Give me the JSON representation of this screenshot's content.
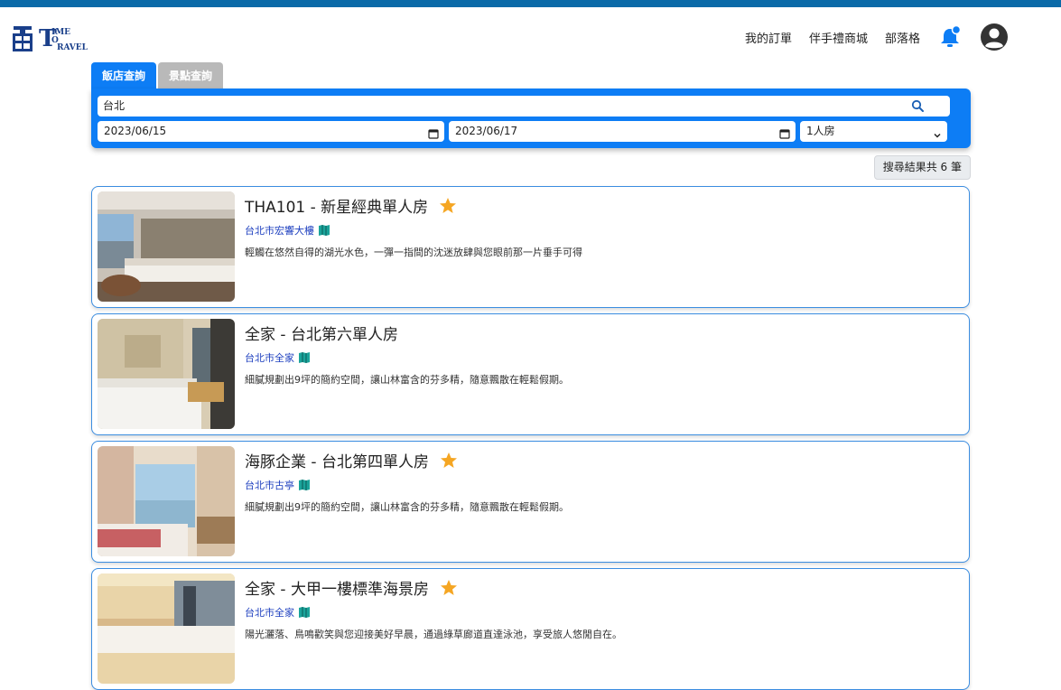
{
  "brand": {
    "logo_lines": [
      "T",
      "IME",
      "O",
      "RAVEL"
    ]
  },
  "nav": {
    "links": [
      "我的訂單",
      "伴手禮商城",
      "部落格"
    ]
  },
  "tabs": [
    {
      "label": "飯店查詢",
      "active": true
    },
    {
      "label": "景點查詢",
      "active": false
    }
  ],
  "search": {
    "keyword": "台北",
    "checkin": "2023/06/15",
    "checkout": "2023/06/17",
    "guests": "1人房"
  },
  "results": {
    "count_label": "搜尋結果共 6 筆",
    "items": [
      {
        "title": "THA101 - 新星經典單人房",
        "starred": true,
        "location": "台北市宏響大樓",
        "description": "輕觸在悠然自得的湖光水色，一彈一指間的沈迷放肆與您眼前那一片垂手可得"
      },
      {
        "title": "全家 - 台北第六單人房",
        "starred": false,
        "location": "台北市全家",
        "description": "細膩規劃出9坪的簡約空間，讓山林富含的芬多精，隨意飄散在輕鬆假期。"
      },
      {
        "title": "海豚企業 - 台北第四單人房",
        "starred": true,
        "location": "台北市古亭",
        "description": "細膩規劃出9坪的簡約空間，讓山林富含的芬多精，隨意飄散在輕鬆假期。"
      },
      {
        "title": "全家 - 大甲一樓標準海景房",
        "starred": true,
        "location": "台北市全家",
        "description": "陽光灑落、鳥鳴歡笑與您迎接美好早晨，通過綠草廊道直達泳池，享受旅人悠閒自在。"
      }
    ]
  },
  "colors": {
    "accent": "#0d7df5",
    "topbar": "#0a6aa8",
    "star": "#f5a623",
    "link": "#1d3fbf",
    "card_border": "#3b8de0"
  }
}
